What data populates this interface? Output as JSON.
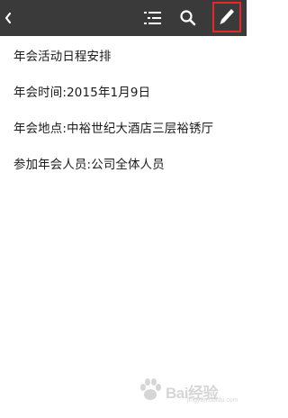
{
  "toolbar": {
    "back_icon": "chevron-left-icon",
    "outline_icon": "list-outline-icon",
    "search_icon": "search-icon",
    "edit_icon": "pencil-icon",
    "background_color": "#3a3a3a",
    "highlight_color": "#e8262b"
  },
  "note": {
    "lines": [
      "年会活动日程安排",
      "年会时间:2015年1月9日",
      "年会地点:中裕世纪大酒店三层裕锈厅",
      "参加年会人员:公司全体人员"
    ]
  },
  "watermark": {
    "text": "Bai经验",
    "sub": "jingyan.baidu.com"
  }
}
